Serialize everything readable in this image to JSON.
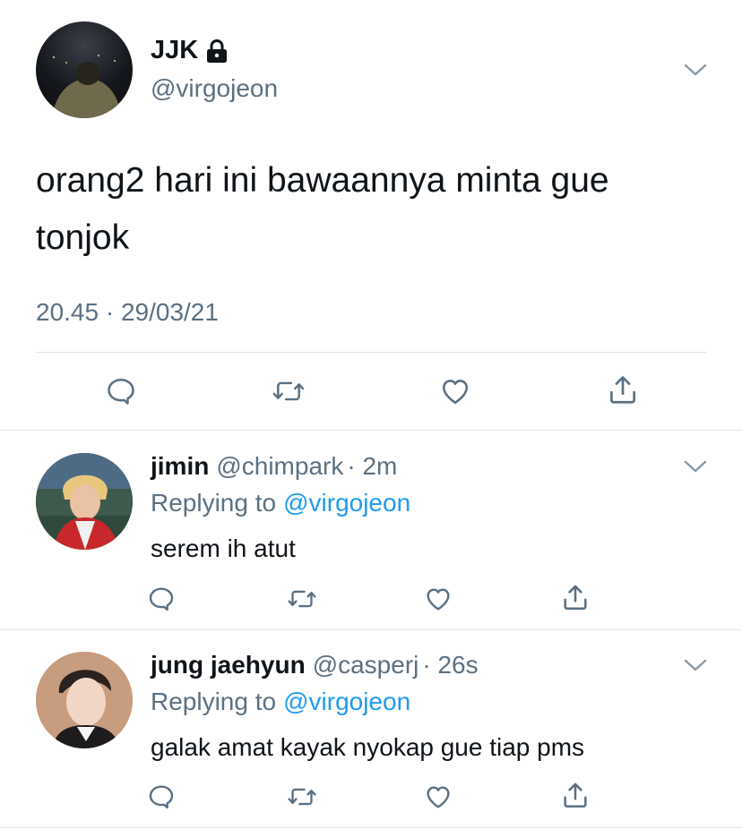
{
  "main_tweet": {
    "display_name": "JJK",
    "handle": "@virgojeon",
    "text_line1": "orang2 hari ini bawaannya minta gue",
    "text_line2": "tonjok",
    "timestamp": "20.45 · 29/03/21",
    "icons": [
      "chevron-down-icon",
      "lock-icon",
      "reply-icon",
      "retweet-icon",
      "like-icon",
      "share-icon"
    ]
  },
  "replies": [
    {
      "display_name": "jimin",
      "handle": "@chimpark",
      "time": "· 2m",
      "replying_prefix": "Replying to",
      "replying_handle": "@virgojeon",
      "text": "serem ih atut"
    },
    {
      "display_name": "jung jaehyun",
      "handle": "@casperj",
      "time": "· 26s",
      "replying_prefix": "Replying to",
      "replying_handle": "@virgojeon",
      "text": "galak amat kayak nyokap gue tiap pms"
    }
  ],
  "colors": {
    "text": "#0f1419",
    "secondary": "#5b7083",
    "link": "#1d9bf0",
    "divider": "#dfe3e7"
  }
}
